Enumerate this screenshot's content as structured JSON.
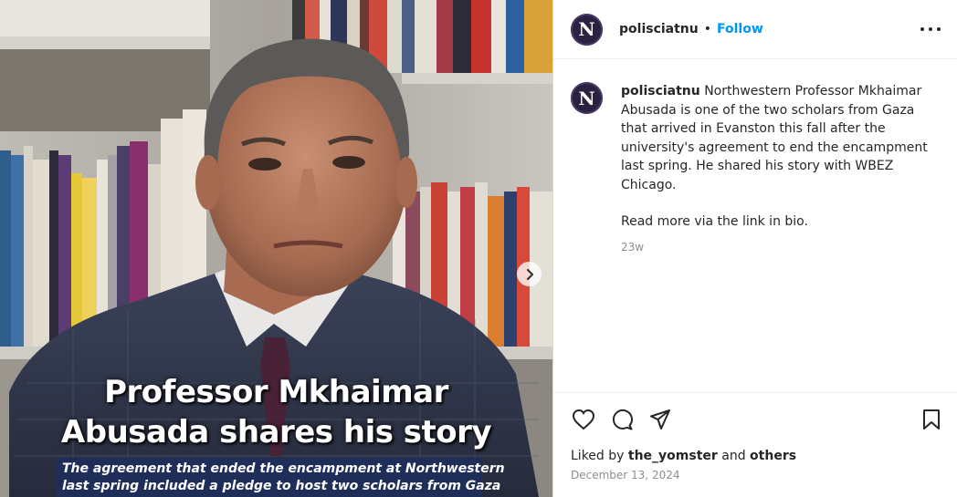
{
  "post": {
    "author": "polisciatnu",
    "separator": "•",
    "follow_label": "Follow",
    "caption_text": "Northwestern Professor Mkhaimar Abusada is one of the two scholars from Gaza that arrived in Evanston this fall after the university's agreement to end the encampment last spring. He shared his story with WBEZ Chicago.",
    "caption_more": "Read more via the link in bio.",
    "time_ago": "23w",
    "liked_prefix": "Liked by",
    "liked_user": "the_yomster",
    "liked_and": "and",
    "liked_others": "others",
    "date": "December 13, 2024"
  },
  "avatar_letter": "N",
  "media": {
    "title_line1": "Professor Mkhaimar",
    "title_line2": "Abusada shares his story",
    "subtitle_line1": "The agreement that ended the encampment at Northwestern",
    "subtitle_line2": "last spring included a pledge to host two scholars from Gaza"
  },
  "icons": {
    "more": "more-options-icon",
    "next": "chevron-right-icon",
    "like": "heart-icon",
    "comment": "comment-icon",
    "share": "share-icon",
    "save": "bookmark-icon"
  },
  "colors": {
    "accent": "#0095f6",
    "secondary_text": "#8e8e8e",
    "subtitle_band": "#1f2d59"
  }
}
